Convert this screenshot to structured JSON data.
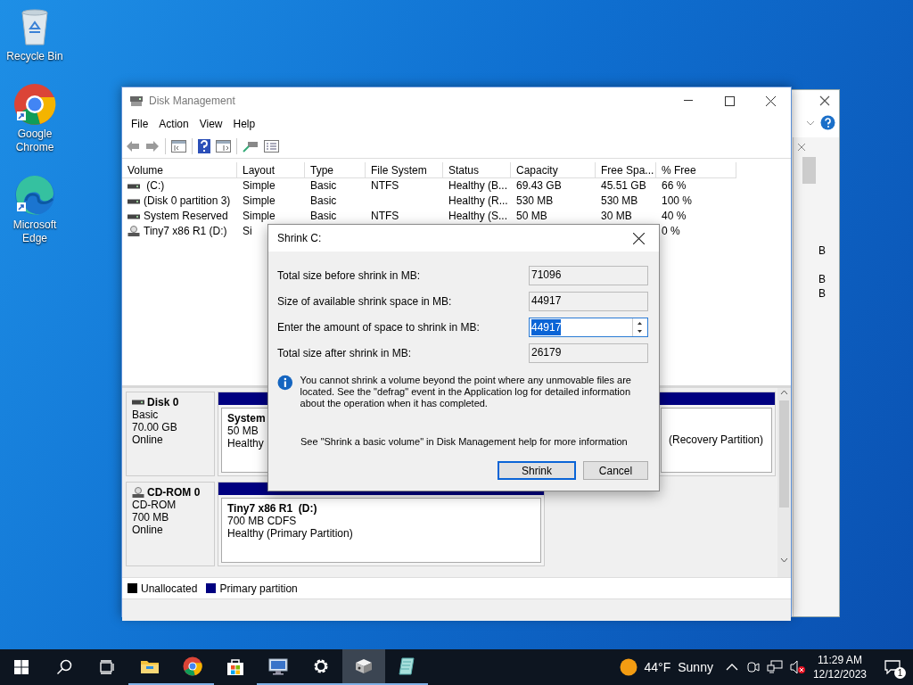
{
  "desktop_icons": [
    {
      "label": "Recycle Bin",
      "kind": "recycle"
    },
    {
      "label": "Google Chrome",
      "kind": "chrome"
    },
    {
      "label": "Microsoft Edge",
      "kind": "edge"
    }
  ],
  "back_window": {
    "partial_cells": [
      "B",
      "B",
      "B"
    ]
  },
  "window": {
    "title": "Disk Management",
    "menu": [
      "File",
      "Action",
      "View",
      "Help"
    ],
    "columns": [
      "Volume",
      "Layout",
      "Type",
      "File System",
      "Status",
      "Capacity",
      "Free Spa...",
      "% Free"
    ],
    "rows": [
      {
        "kind": "disk",
        "volume": " (C:)",
        "layout": "Simple",
        "type": "Basic",
        "file_system": "NTFS",
        "status": "Healthy (B...",
        "capacity": "69.43 GB",
        "free_space": "45.51 GB",
        "percent_free": "66 %"
      },
      {
        "kind": "disk",
        "volume": "(Disk 0 partition 3)",
        "layout": "Simple",
        "type": "Basic",
        "status": "Healthy (R...",
        "capacity": "530 MB",
        "free_space": "530 MB",
        "percent_free": "100 %"
      },
      {
        "kind": "disk",
        "volume": "System Reserved",
        "layout": "Simple",
        "type": "Basic",
        "file_system": "NTFS",
        "status": "Healthy (S...",
        "capacity": "50 MB",
        "free_space": "30 MB",
        "percent_free": "40 %"
      },
      {
        "kind": "cd",
        "volume": "Tiny7 x86 R1 (D:)",
        "layout": "Si",
        "percent_free": "0 %"
      }
    ],
    "disks": [
      {
        "kind": "disk",
        "name": "Disk 0",
        "lines": [
          "Basic",
          "70.00 GB",
          "Online"
        ],
        "partitions": [
          {
            "title": "System",
            "lines": [
              "50 MB",
              "Healthy"
            ]
          },
          {
            "lines": [
              "(Recovery Partition)"
            ]
          }
        ]
      },
      {
        "kind": "cd",
        "name": "CD-ROM 0",
        "lines": [
          "CD-ROM",
          "700 MB",
          "Online"
        ],
        "partitions": [
          {
            "title": "Tiny7 x86 R1  (D:)",
            "lines": [
              "700 MB CDFS",
              "Healthy (Primary Partition)"
            ]
          }
        ]
      }
    ],
    "legend": [
      {
        "label": "Unallocated",
        "color": "#000000"
      },
      {
        "label": "Primary partition",
        "color": "#000080"
      }
    ]
  },
  "dialog": {
    "title": "Shrink C:",
    "fields": [
      {
        "label": "Total size before shrink in MB:",
        "value": "71096",
        "editable": false
      },
      {
        "label": "Size of available shrink space in MB:",
        "value": "44917",
        "editable": false
      },
      {
        "label": "Enter the amount of space to shrink in MB:",
        "value": "44917",
        "editable": true
      },
      {
        "label": "Total size after shrink in MB:",
        "value": "26179",
        "editable": false
      }
    ],
    "info": "You cannot shrink a volume beyond the point where any unmovable files are located. See the \"defrag\" event in the Application log for detailed information about the operation when it has completed.",
    "help": "See \"Shrink a basic volume\" in Disk Management help for more information",
    "buttons": [
      {
        "label": "Shrink",
        "default": true
      },
      {
        "label": "Cancel",
        "default": false
      }
    ]
  },
  "taskbar": {
    "apps": [
      {
        "kind": "explorer",
        "running": true,
        "selected": false
      },
      {
        "kind": "chrome",
        "running": true,
        "selected": false
      },
      {
        "kind": "store",
        "running": false,
        "selected": false
      },
      {
        "kind": "monitor",
        "running": true,
        "selected": false
      },
      {
        "kind": "settings",
        "running": true,
        "selected": false
      },
      {
        "kind": "diskmgmt",
        "running": true,
        "selected": true
      },
      {
        "kind": "notepad",
        "running": true,
        "selected": false
      }
    ],
    "temperature": "44°F",
    "weather": "Sunny",
    "time": "11:29 AM",
    "date": "12/12/2023",
    "notifications": "1"
  }
}
